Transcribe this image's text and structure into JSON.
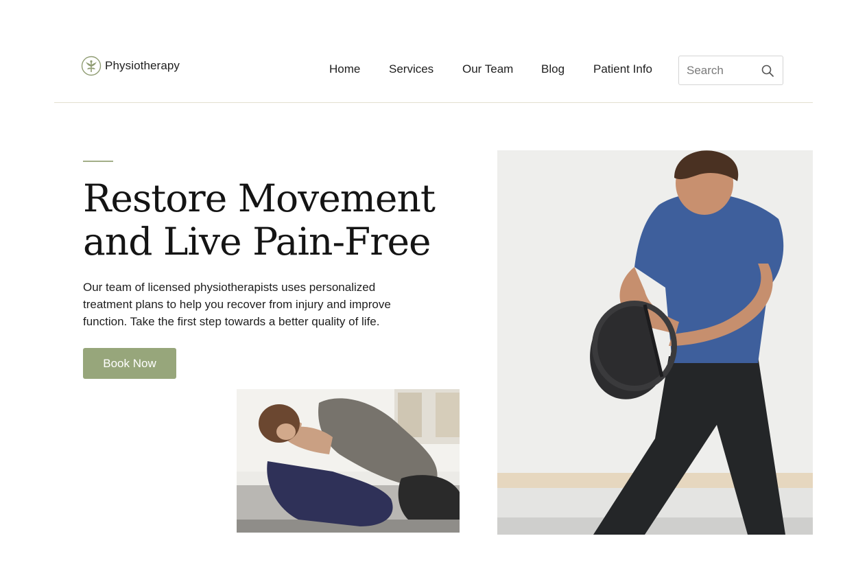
{
  "brand": {
    "name": "Physiotherapy",
    "icon": "leaf-logo-icon",
    "accent_color": "#97a67b"
  },
  "nav": {
    "items": [
      {
        "label": "Home"
      },
      {
        "label": "Services"
      },
      {
        "label": "Our Team"
      },
      {
        "label": "Blog"
      },
      {
        "label": "Patient Info"
      }
    ]
  },
  "search": {
    "placeholder": "Search",
    "icon": "search-icon"
  },
  "hero": {
    "title_line1": "Restore Movement",
    "title_line2": "and Live Pain-Free",
    "subtitle": "Our team of licensed physiotherapists uses personalized treatment plans to help you recover from injury and improve function.  Take the first step towards a better quality of life.",
    "cta_label": "Book Now"
  }
}
